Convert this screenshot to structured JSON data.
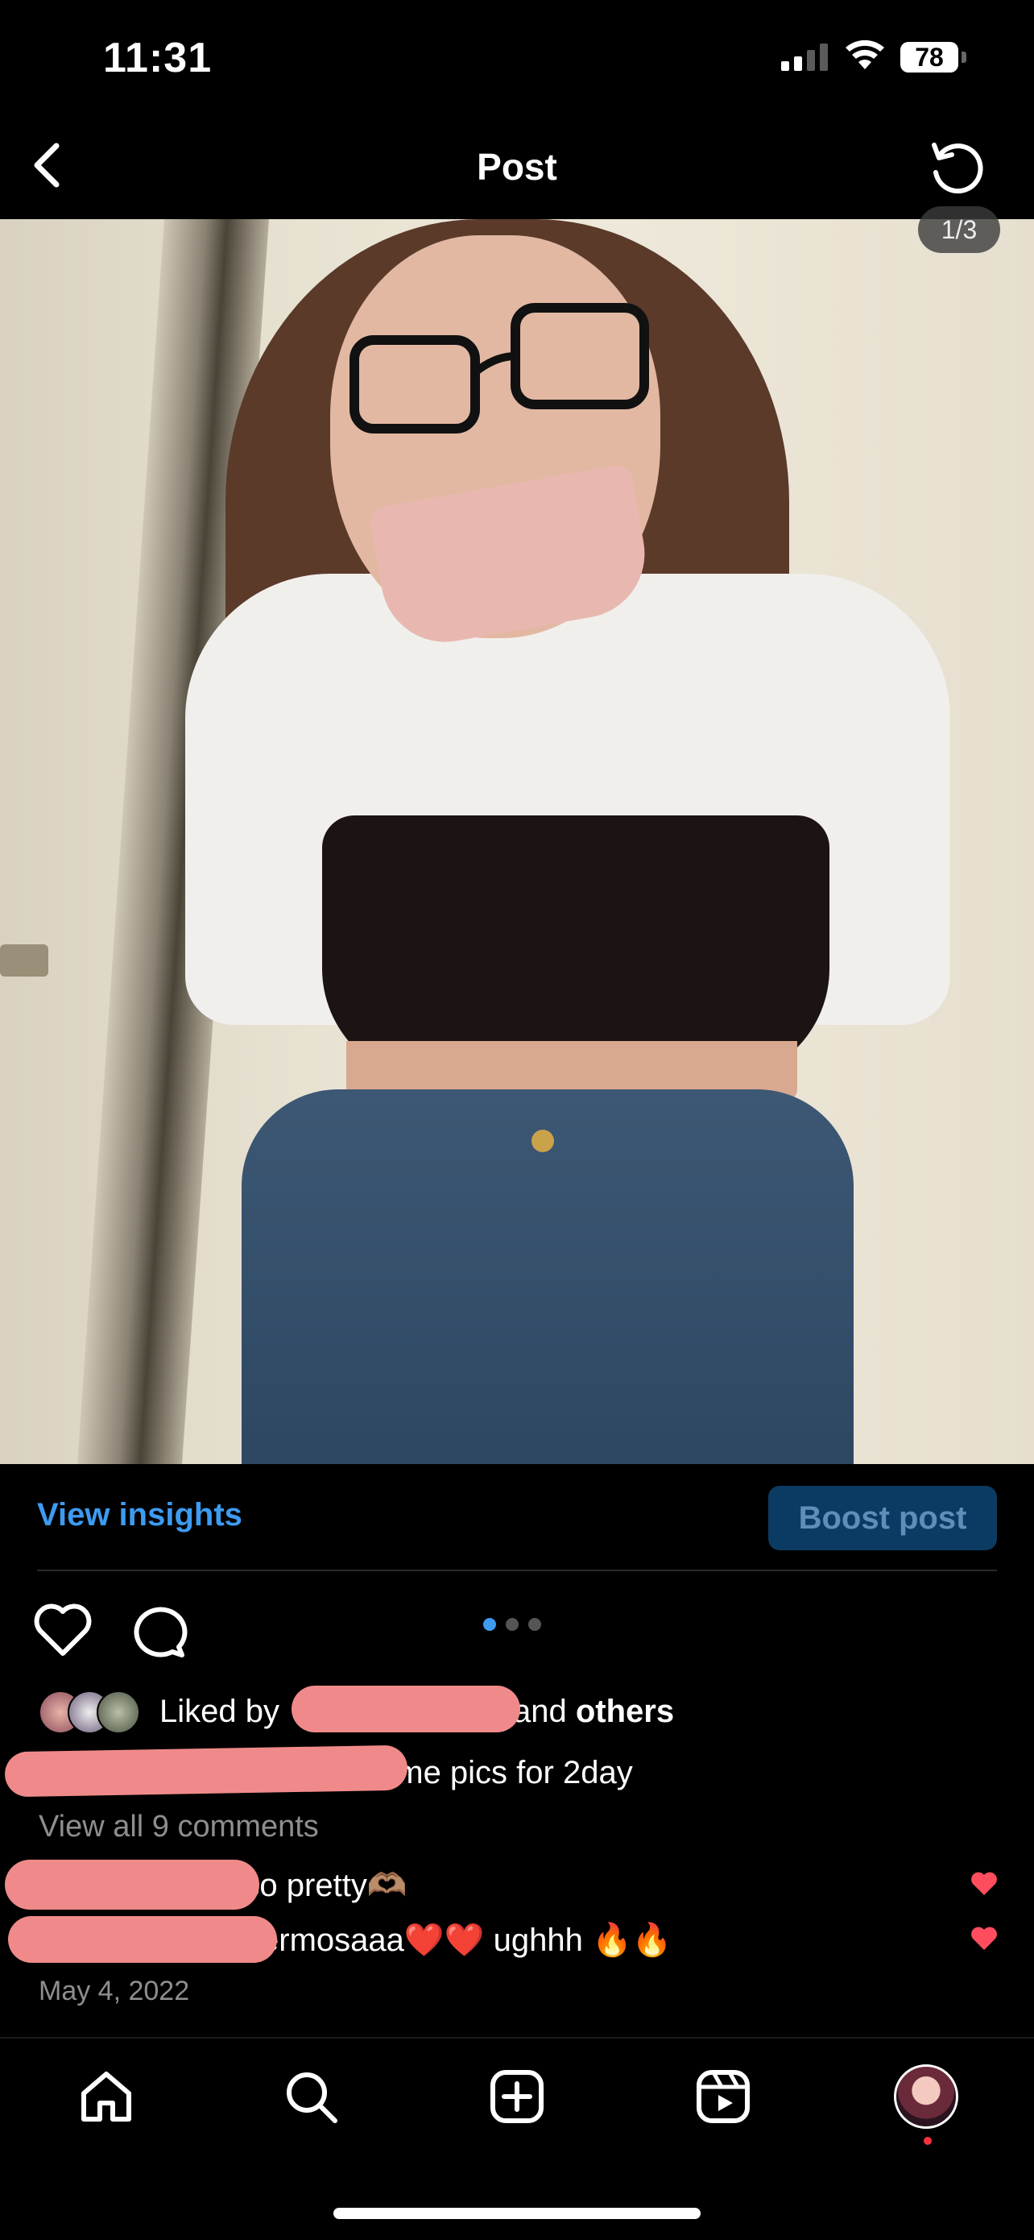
{
  "status_bar": {
    "time": "11:31",
    "battery": "78"
  },
  "header": {
    "title": "Post"
  },
  "post": {
    "image_counter": "1/3",
    "carousel": {
      "current": 1,
      "total": 3
    }
  },
  "insights": {
    "view_insights_label": "View insights",
    "boost_label": "Boost post"
  },
  "likes": {
    "liked_by_prefix": "Liked by",
    "and_label": "and",
    "others_label": "others"
  },
  "caption": {
    "text": "ome pics for 2day"
  },
  "comments": {
    "view_all": "View all 9 comments",
    "items": [
      {
        "text": "r so pretty🫶🏽"
      },
      {
        "text": "ermosaaa❤️❤️ ughhh 🔥🔥"
      }
    ]
  },
  "date": "May 4, 2022",
  "colors": {
    "accent_blue": "#3d9bf0",
    "boost_bg": "#0b3b63",
    "heart_red": "#ff4d5e",
    "redaction": "#f08a8a"
  },
  "tab_bar": {
    "items": [
      "home-icon",
      "search-icon",
      "create-icon",
      "reels-icon",
      "profile-avatar"
    ]
  }
}
